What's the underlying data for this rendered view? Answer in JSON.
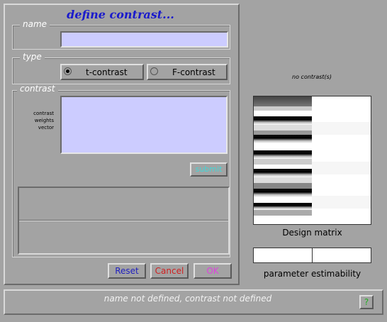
{
  "dialog": {
    "title": "define contrast...",
    "name_group_label": "name",
    "name_value": "",
    "type_group_label": "type",
    "type_options": [
      {
        "label": "t-contrast",
        "selected": true
      },
      {
        "label": "F-contrast",
        "selected": false
      }
    ],
    "contrast_group_label": "contrast",
    "weights_label_lines": [
      "contrast",
      "weights",
      "vector"
    ],
    "weights_value": "",
    "submit_label": "submit",
    "buttons": {
      "reset": "Reset",
      "cancel": "Cancel",
      "ok": "OK"
    },
    "status_text": "name not defined, contrast not defined",
    "help_label": "?"
  },
  "design": {
    "title": "no contrast(s)",
    "matrix_caption": "Design matrix",
    "estimability_caption": "parameter estimability"
  },
  "colors": {
    "title_blue": "#1a1acc",
    "field_bg": "#ccccff",
    "submit_cyan": "#3fd8d8",
    "reset_blue": "#2020c0",
    "cancel_red": "#d02020",
    "ok_magenta": "#e040e0",
    "help_green": "#20b020"
  }
}
